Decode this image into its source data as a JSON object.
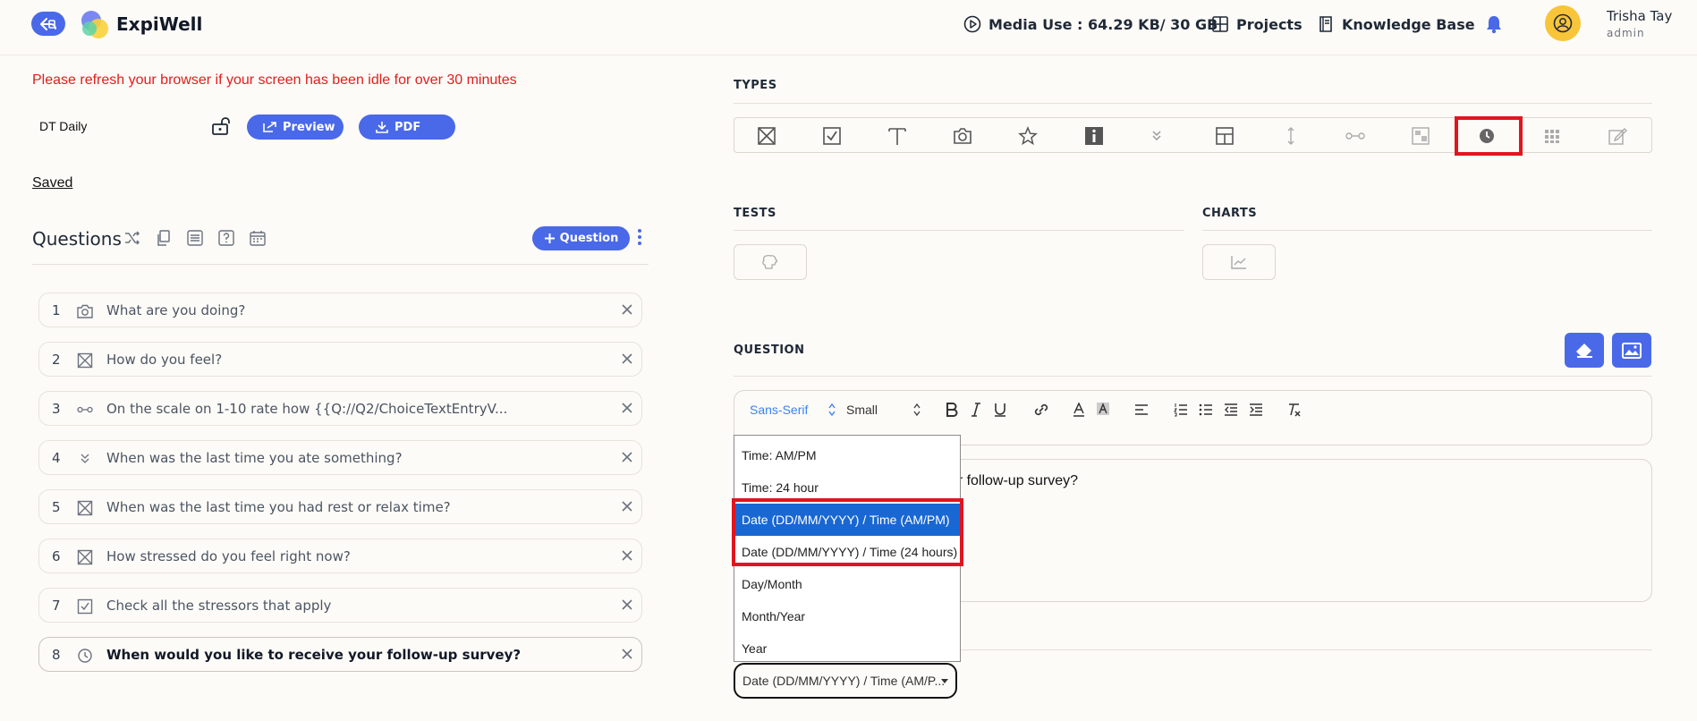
{
  "header": {
    "brand": "ExpiWell",
    "media_use": "Media Use : 64.29 KB/ 30 GB",
    "projects": "Projects",
    "knowledge_base": "Knowledge Base",
    "user_name": "Trisha Tay",
    "user_role": "admin"
  },
  "notice": "Please refresh your browser if your screen has been idle for over 30 minutes",
  "survey": {
    "title": "DT Daily",
    "preview_label": "Preview",
    "pdf_label": "PDF",
    "saved_label": "Saved"
  },
  "questions": {
    "heading": "Questions",
    "add_label": "Question",
    "items": [
      {
        "num": "1",
        "icon": "camera-icon",
        "text": "What are you doing?"
      },
      {
        "num": "2",
        "icon": "multiple-choice-icon",
        "text": "How do you feel?"
      },
      {
        "num": "3",
        "icon": "slider-icon",
        "text": "On the scale on 1-10 rate how {{Q://Q2/ChoiceTextEntryV..."
      },
      {
        "num": "4",
        "icon": "dropdown-icon",
        "text": "When was the last time you ate something?"
      },
      {
        "num": "5",
        "icon": "multiple-choice-icon",
        "text": "When was the last time you had rest or relax time?"
      },
      {
        "num": "6",
        "icon": "multiple-choice-icon",
        "text": "How stressed do you feel right now?"
      },
      {
        "num": "7",
        "icon": "checkbox-icon",
        "text": "Check all the stressors that apply"
      },
      {
        "num": "8",
        "icon": "clock-icon",
        "text": "When would you like to receive your follow-up survey?"
      }
    ]
  },
  "panel": {
    "types_label": "TYPES",
    "tests_label": "TESTS",
    "charts_label": "CHARTS",
    "question_label": "QUESTION"
  },
  "editor": {
    "font": "Sans-Serif",
    "size": "Small",
    "text_visible": "our follow-up survey?"
  },
  "dropdown": {
    "options": [
      "Time: AM/PM",
      "Time: 24 hour",
      "Date (DD/MM/YYYY) / Time (AM/PM)",
      "Date (DD/MM/YYYY) / Time (24 hours)",
      "Day/Month",
      "Month/Year",
      "Year"
    ],
    "selected_index": 2,
    "selected_display": "Date (DD/MM/YYYY) / Time (AM/P..."
  },
  "colors": {
    "accent": "#4a69e8",
    "highlight": "#e0161f",
    "notice": "#e11d1d",
    "selected_option": "#1967d2"
  }
}
